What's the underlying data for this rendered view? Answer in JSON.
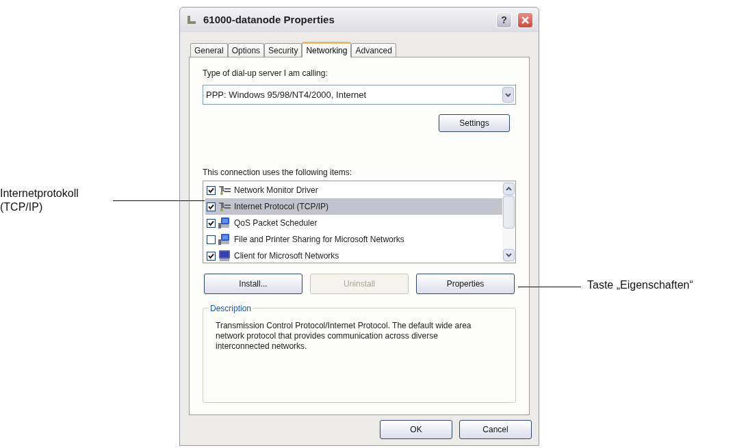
{
  "window": {
    "title": "61000-datanode Properties",
    "help_button": "?"
  },
  "tabs": [
    {
      "label": "General",
      "selected": false
    },
    {
      "label": "Options",
      "selected": false
    },
    {
      "label": "Security",
      "selected": false
    },
    {
      "label": "Networking",
      "selected": true
    },
    {
      "label": "Advanced",
      "selected": false
    }
  ],
  "server_type": {
    "label": "Type of dial-up server I am calling:",
    "value": "PPP: Windows 95/98/NT4/2000, Internet"
  },
  "settings_button": {
    "label": "Settings",
    "disabled": false
  },
  "items_label": "This connection uses the following items:",
  "items": [
    {
      "label": "Network Monitor Driver",
      "checked": true,
      "selected": false,
      "kind": "protocol"
    },
    {
      "label": "Internet Protocol (TCP/IP)",
      "checked": true,
      "selected": true,
      "kind": "protocol"
    },
    {
      "label": "QoS Packet Scheduler",
      "checked": true,
      "selected": false,
      "kind": "service"
    },
    {
      "label": "File and Printer Sharing for Microsoft Networks",
      "checked": false,
      "selected": false,
      "kind": "service"
    },
    {
      "label": "Client for Microsoft Networks",
      "checked": true,
      "selected": false,
      "kind": "client"
    }
  ],
  "item_buttons": [
    {
      "label": "Install...",
      "disabled": false
    },
    {
      "label": "Uninstall",
      "disabled": true
    },
    {
      "label": "Properties",
      "disabled": false
    }
  ],
  "description": {
    "title": "Description",
    "text": "Transmission Control Protocol/Internet Protocol. The default wide area network protocol that provides communication across diverse interconnected networks."
  },
  "dialog_buttons": [
    {
      "label": "OK",
      "disabled": false
    },
    {
      "label": "Cancel",
      "disabled": false
    }
  ],
  "callouts": [
    {
      "kind": "left",
      "text": "Internetprotokoll (TCP/IP)"
    },
    {
      "kind": "right",
      "text": "Taste „Eigenschaften“"
    }
  ]
}
